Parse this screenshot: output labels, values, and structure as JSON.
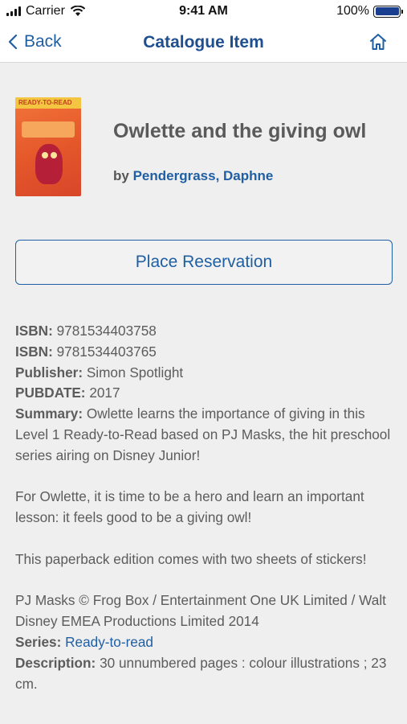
{
  "status_bar": {
    "carrier": "Carrier",
    "time": "9:41 AM",
    "battery_percent": "100%",
    "battery_level": 1.0
  },
  "nav": {
    "back_label": "Back",
    "title": "Catalogue Item",
    "home_icon": "home-icon",
    "back_icon": "chevron-left-icon"
  },
  "book": {
    "title": "Owlette and the giving owl",
    "by_prefix": "by",
    "author": "Pendergrass, Daphne",
    "cover_banner": "READY-TO-READ"
  },
  "actions": {
    "reserve_label": "Place Reservation"
  },
  "details": {
    "isbn_label": "ISBN:",
    "isbn1": "9781534403758",
    "isbn2": "9781534403765",
    "publisher_label": "Publisher:",
    "publisher": "Simon Spotlight",
    "pubdate_label": "PUBDATE:",
    "pubdate": "2017",
    "summary_label": "Summary:",
    "summary_p1": "Owlette learns the importance of giving in this Level 1 Ready-to-Read based on PJ Masks, the hit preschool series airing on Disney Junior!",
    "summary_p2": "For Owlette, it is time to be a hero and learn an important lesson: it feels good to be a giving owl!",
    "summary_p3": "This paperback edition comes with two sheets of stickers!",
    "summary_p4": "PJ Masks © Frog Box / Entertainment One UK Limited / Walt Disney EMEA Productions Limited 2014",
    "series_label": "Series:",
    "series": "Ready-to-read",
    "description_label": "Description:",
    "description": "30 unnumbered pages : colour illustrations ; 23 cm."
  },
  "colors": {
    "accent": "#1f5fa3",
    "title_blue": "#1f4f8f",
    "background": "#efefef",
    "text": "#5c5c5c"
  }
}
